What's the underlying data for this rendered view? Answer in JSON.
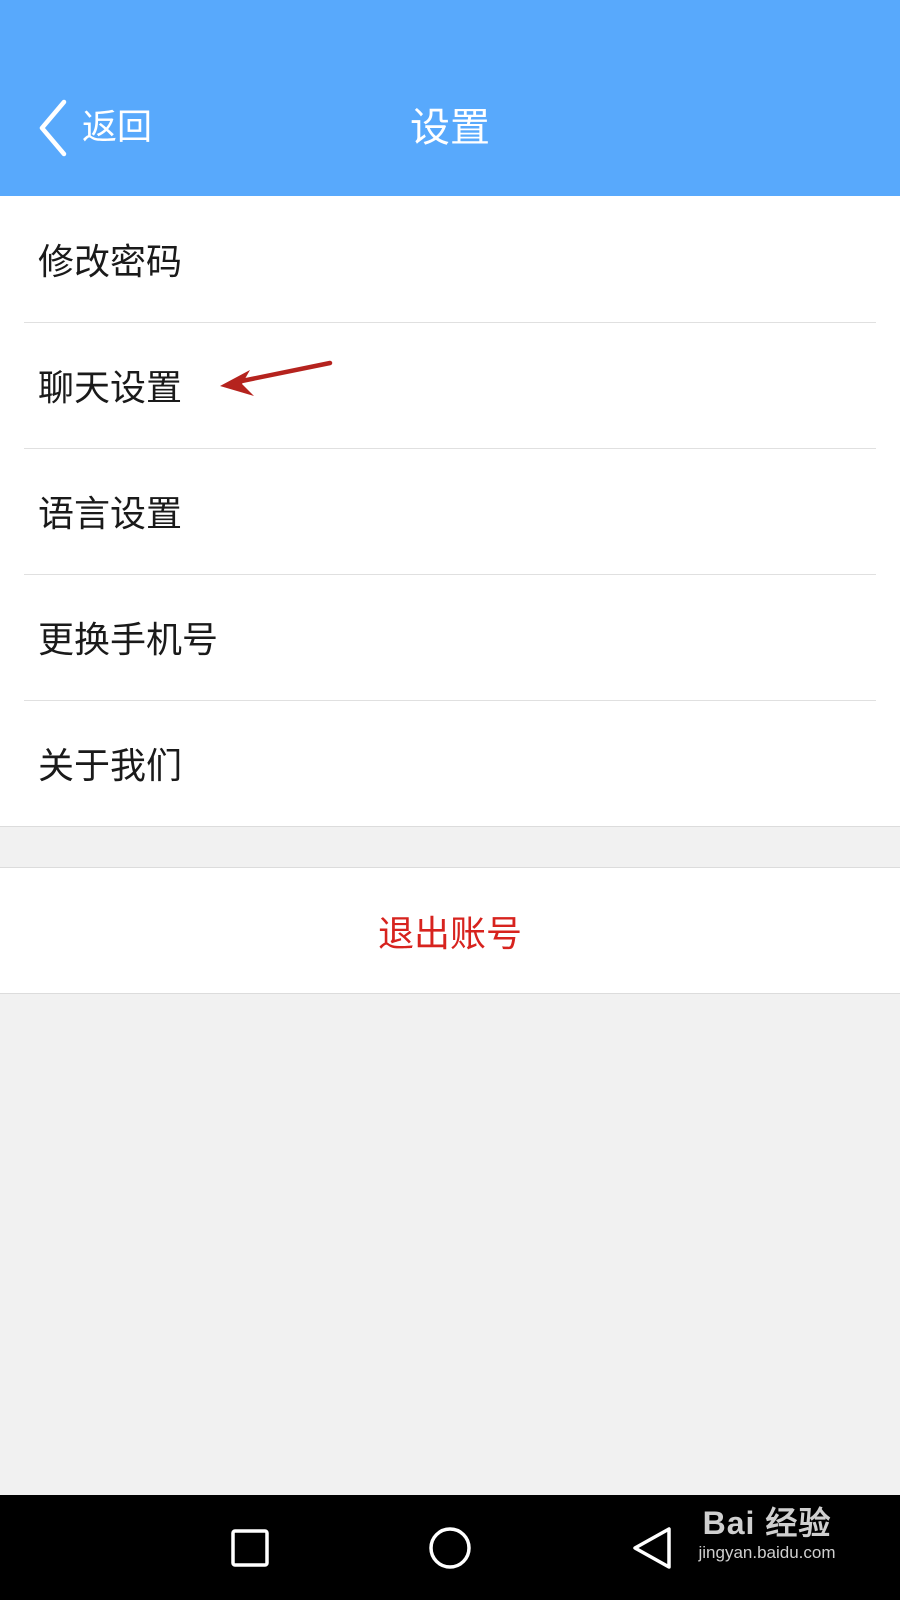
{
  "header": {
    "back_label": "返回",
    "title": "设置",
    "bg_color": "#58a9fc"
  },
  "menu": {
    "items": [
      {
        "label": "修改密码"
      },
      {
        "label": "聊天设置",
        "annotated": true
      },
      {
        "label": "语言设置"
      },
      {
        "label": "更换手机号"
      },
      {
        "label": "关于我们"
      }
    ]
  },
  "logout": {
    "label": "退出账号",
    "color": "#d7231e"
  },
  "annotation": {
    "type": "arrow",
    "color": "#b5231e"
  },
  "navbar": {
    "icons": [
      "recent-apps-icon",
      "home-icon",
      "back-triangle-icon"
    ]
  },
  "watermark": {
    "line1": "Bai 经验",
    "line2": "jingyan.baidu.com"
  }
}
